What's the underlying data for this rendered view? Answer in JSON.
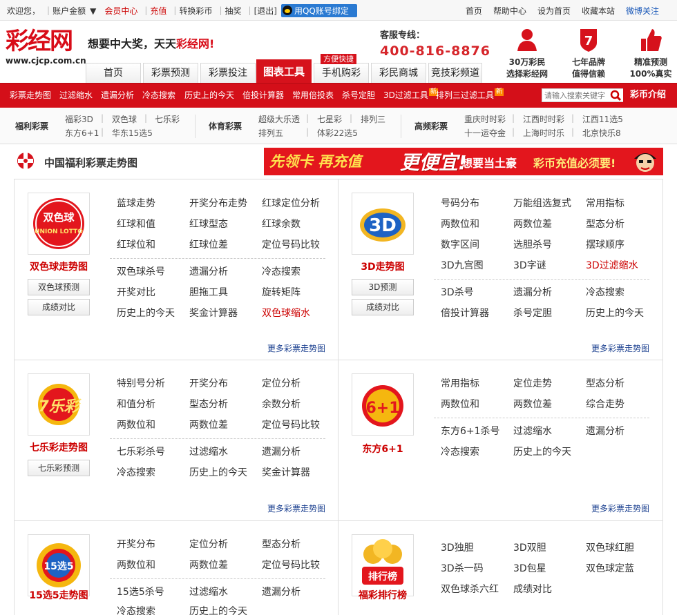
{
  "topbar": {
    "welcome": "欢迎您，",
    "account": "账户金额",
    "member": "会员中心",
    "recharge": "充值",
    "exchange": "转换彩币",
    "lottery": "抽奖",
    "logout": "[退出]",
    "qq_bind": "用QQ账号绑定",
    "right": [
      "首页",
      "帮助中心",
      "设为首页",
      "收藏本站",
      "微博关注"
    ]
  },
  "header": {
    "logo_text": "彩经网",
    "logo_url": "www.cjcp.com.cn",
    "slogan_a": "想要中大奖，天天",
    "slogan_b": "彩经网!",
    "hotline_label": "客服专线：",
    "hotline": "400-816-8876",
    "features": [
      {
        "line1": "30万彩民",
        "line2": "选择彩经网"
      },
      {
        "line1": "七年品牌",
        "line2": "值得信赖"
      },
      {
        "line1": "精准预测",
        "line2": "100%真实"
      }
    ]
  },
  "nav": {
    "tabs": [
      "首页",
      "彩票预测",
      "彩票投注",
      "图表工具",
      "手机购彩",
      "彩民商城",
      "竞技彩频道"
    ],
    "badge": "方便快捷"
  },
  "redbar": {
    "items": [
      "彩票走势图",
      "过滤缩水",
      "遗漏分析",
      "冷态搜索",
      "历史上的今天",
      "倍投计算器",
      "常用倍投表",
      "杀号定胆",
      "3D过滤工具",
      "排列三过滤工具"
    ],
    "new": "新",
    "search_placeholder": "请输入搜索关键字",
    "intro": "彩币介绍"
  },
  "catbar": {
    "welfare": {
      "label": "福利彩票",
      "links": [
        "福彩3D",
        "双色球",
        "七乐彩",
        "东方6+1",
        "华东15选5"
      ]
    },
    "sports": {
      "label": "体育彩票",
      "links": [
        "超级大乐透",
        "七星彩",
        "排列三",
        "排列五",
        "体彩22选5"
      ]
    },
    "high": {
      "label": "高频彩票",
      "links": [
        "重庆时时彩",
        "江西时时彩",
        "江西11选5",
        "十一运夺金",
        "上海时时乐",
        "北京快乐8"
      ]
    }
  },
  "section": {
    "title": "中国福利彩票走势图"
  },
  "banner": {
    "a": "先领卡 再充值",
    "b": "更便宜!",
    "c": "想要当土豪",
    "d": "彩币充值必须要!"
  },
  "panels": {
    "ssq": {
      "name": "双色球走势图",
      "logo": "双色球",
      "logo_sub": "UNION LOTTO",
      "btn1": "双色球预测",
      "btn2": "成绩对比",
      "links": [
        "蓝球走势",
        "开奖分布走势",
        "红球定位分析",
        "红球和值",
        "红球型态",
        "红球余数",
        "红球位和",
        "红球位差",
        "定位号码比较",
        "双色球杀号",
        "遗漏分析",
        "冷态搜索",
        "开奖对比",
        "胆拖工具",
        "旋转矩阵",
        "历史上的今天",
        "奖金计算器",
        "双色球缩水"
      ],
      "more": "更多彩票走势图"
    },
    "d3": {
      "name": "3D走势图",
      "logo": "3D",
      "btn1": "3D预测",
      "btn2": "成绩对比",
      "links": [
        "号码分布",
        "万能组选复式",
        "常用指标",
        "两数位和",
        "两数位差",
        "型态分析",
        "数字区间",
        "选胆杀号",
        "摆球顺序",
        "3D九宫图",
        "3D字谜",
        "3D过滤缩水",
        "3D杀号",
        "遗漏分析",
        "冷态搜索",
        "倍投计算器",
        "杀号定胆",
        "历史上的今天"
      ],
      "more": "更多彩票走势图"
    },
    "qlc": {
      "name": "七乐彩走势图",
      "logo": "7乐彩",
      "btn1": "七乐彩预测",
      "links": [
        "特别号分析",
        "开奖分布",
        "定位分析",
        "和值分析",
        "型态分析",
        "余数分析",
        "两数位和",
        "两数位差",
        "定位号码比较",
        "七乐彩杀号",
        "过滤缩水",
        "遗漏分析",
        "冷态搜索",
        "历史上的今天",
        "奖金计算器"
      ],
      "more": "更多彩票走势图"
    },
    "df": {
      "name": "东方6+1",
      "logo": "6+1",
      "links": [
        "常用指标",
        "定位走势",
        "型态分析",
        "两数位和",
        "两数位差",
        "综合走势",
        "东方6+1杀号",
        "过滤缩水",
        "遗漏分析",
        "冷态搜索",
        "历史上的今天"
      ],
      "more": "更多彩票走势图"
    },
    "x15": {
      "name": "15选5走势图",
      "logo": "15选5",
      "links": [
        "开奖分布",
        "定位分析",
        "型态分析",
        "两数位和",
        "两数位差",
        "定位号码比较",
        "15选5杀号",
        "过滤缩水",
        "遗漏分析",
        "冷态搜索",
        "历史上的今天"
      ]
    },
    "rank": {
      "name": "福彩排行榜",
      "logo": "排行榜",
      "links": [
        "3D独胆",
        "3D双胆",
        "双色球红胆",
        "3D杀一码",
        "3D包星",
        "双色球定蓝",
        "双色球杀六红",
        "成绩对比"
      ]
    }
  }
}
